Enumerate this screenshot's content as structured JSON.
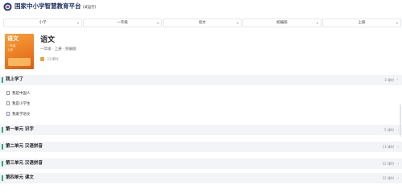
{
  "header": {
    "brand": "国家中小学智慧教育平台",
    "brand_sub": "(试运行)"
  },
  "filters": [
    {
      "value": "小学"
    },
    {
      "value": "一年级"
    },
    {
      "value": "语文"
    },
    {
      "value": "统编版"
    },
    {
      "value": "上册"
    }
  ],
  "book": {
    "cover_title": "语文",
    "cover_grade": "一年级",
    "cover_volume": "上册",
    "subject": "语文",
    "meta": "一年级 · 上册 · 统编版",
    "lesson_count": "31课时"
  },
  "sections": [
    {
      "title": "我上学了",
      "count": "3 课时",
      "lessons": [
        "我是中国人",
        "我是小学生",
        "我爱学语文"
      ]
    },
    {
      "title": "第一单元 识字",
      "count": "5 课时"
    },
    {
      "title": "第二单元 汉语拼音",
      "count": "13 课时"
    },
    {
      "title": "第三单元 汉语拼音",
      "count": "12 课时"
    },
    {
      "title": "第四单元 课文",
      "count": "12 课时"
    }
  ],
  "icons": {
    "logo": "circular-logo-icon",
    "dropdown": "chevron-down-icon",
    "lesson": "document-icon",
    "expand": "chevron-right-icon"
  },
  "colors": {
    "accent": "#2fa97a",
    "cover": "#e8731d",
    "section_bg": "#f3f4f8"
  }
}
